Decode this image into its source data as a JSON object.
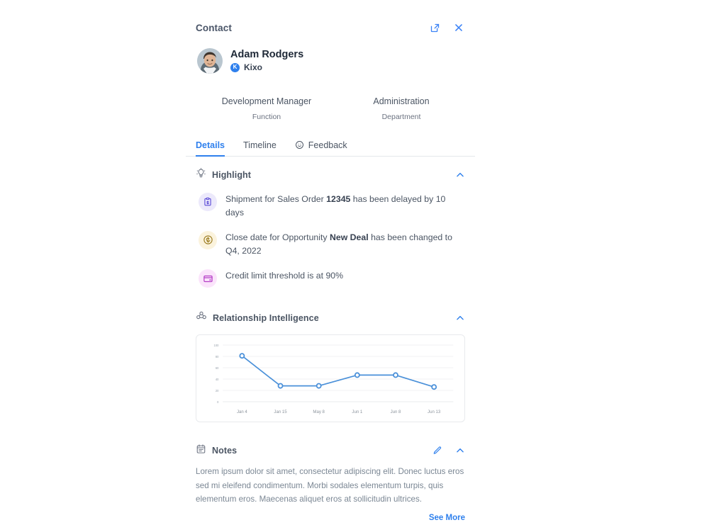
{
  "panel": {
    "title": "Contact",
    "actions": [
      {
        "name": "open-in-new-icon",
        "label": "Open in new window"
      },
      {
        "name": "close-icon",
        "label": "Close"
      }
    ]
  },
  "identity": {
    "name": "Adam Rodgers",
    "company": "Kixo",
    "company_initial": "K",
    "avatar_alt": "Adam Rodgers profile photo"
  },
  "attributes": [
    {
      "value": "Development Manager",
      "label": "Function"
    },
    {
      "value": "Administration",
      "label": "Department"
    }
  ],
  "tabs": [
    {
      "label": "Details",
      "active": true,
      "icon": ""
    },
    {
      "label": "Timeline",
      "active": false,
      "icon": ""
    },
    {
      "label": "Feedback",
      "active": false,
      "icon": "smiley-icon"
    }
  ],
  "highlight": {
    "title": "Highlight",
    "icon": "lightbulb-icon",
    "collapse_icon": "chevron-up-icon",
    "items": [
      {
        "icon": "clipboard-dollar-icon",
        "icon_bg": "#ece9fb",
        "icon_color": "#5b4bd6",
        "pre": "Shipment for Sales Order ",
        "strong": "12345",
        "post": " has been delayed by 10 days"
      },
      {
        "icon": "coin-dollar-icon",
        "icon_bg": "#fbf3dd",
        "icon_color": "#9b7b1f",
        "pre": "Close date for Opportunity ",
        "strong": "New Deal",
        "post": " has been changed to Q4, 2022"
      },
      {
        "icon": "credit-card-icon",
        "icon_bg": "#fbe4fb",
        "icon_color": "#b43dc6",
        "pre": "Credit limit threshold is at 90%",
        "strong": "",
        "post": ""
      }
    ]
  },
  "relationship": {
    "title": "Relationship Intelligence",
    "icon": "people-group-icon",
    "collapse_icon": "chevron-up-icon"
  },
  "chart_data": {
    "type": "line",
    "title": "",
    "xlabel": "",
    "ylabel": "",
    "categories": [
      "Jan 4",
      "Jan 15",
      "May 8",
      "Jun 1",
      "Jun 8",
      "Jun 13"
    ],
    "values": [
      81,
      28,
      28,
      47,
      47,
      26
    ],
    "ylim": [
      0,
      100
    ],
    "yticks": [
      0,
      20,
      40,
      60,
      80,
      100
    ],
    "grid": true,
    "legend": "none",
    "line_color": "#4a90d9",
    "marker": "circle-open"
  },
  "notes": {
    "title": "Notes",
    "icon": "calendar-note-icon",
    "edit_icon": "pencil-icon",
    "collapse_icon": "chevron-up-icon",
    "body": "Lorem ipsum dolor sit amet, consectetur adipiscing elit. Donec luctus eros sed mi eleifend condimentum. Morbi sodales elementum turpis, quis elementum eros. Maecenas aliquet eros at sollicitudin ultrices.",
    "see_more": "See More"
  },
  "colors": {
    "accent": "#2f80ed",
    "text": "#4b5563",
    "muted": "#7b8794",
    "divider": "#e5e7eb",
    "chart_line": "#4a90d9"
  }
}
